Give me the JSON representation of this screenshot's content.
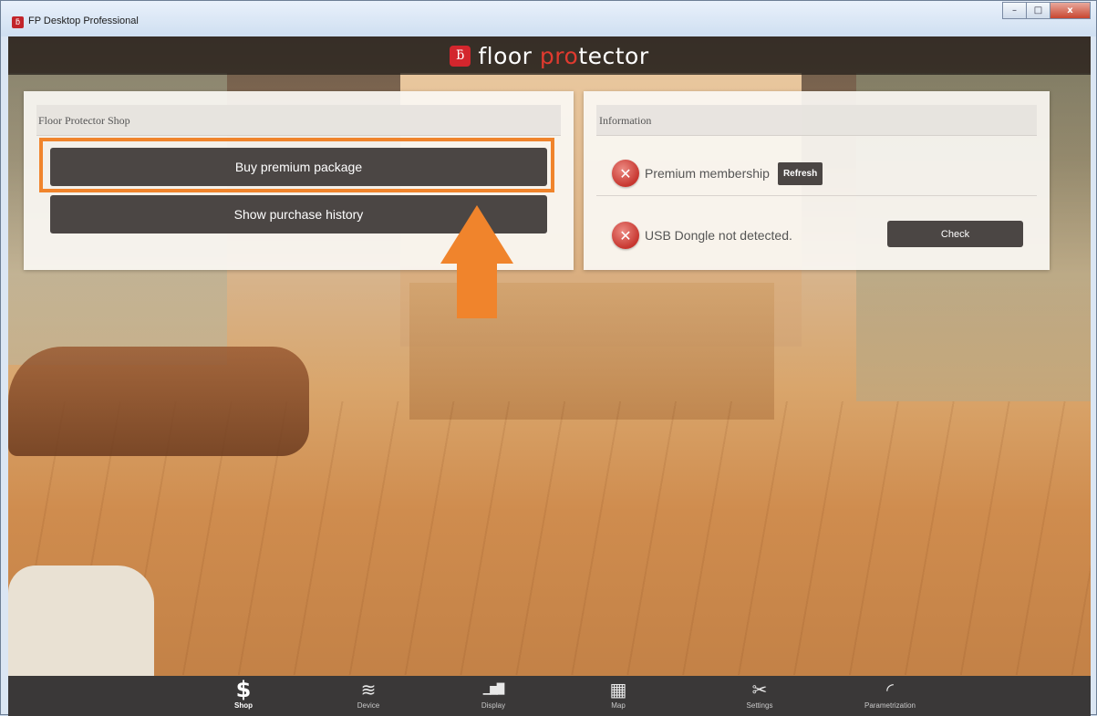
{
  "window": {
    "title": "FP Desktop Professional",
    "app_icon": "floor-protector-logo-icon"
  },
  "window_controls": {
    "minimize": "–",
    "maximize": "□",
    "close": "x"
  },
  "header": {
    "logo_text_main": "floor ",
    "logo_text_accent": "pro",
    "logo_text_end": "tector",
    "logo_mark": "ƃ",
    "accent_color": "#e03a2f"
  },
  "shop": {
    "title": "Floor Protector Shop",
    "buy_label": "Buy premium package",
    "history_label": "Show purchase history",
    "highlight_color": "#f0842c"
  },
  "info": {
    "title": "Information",
    "premium_label": "Premium membership",
    "refresh_label": "Refresh",
    "usb_label": "USB Dongle not detected.",
    "check_label": "Check",
    "error_icon_glyph": "✕",
    "error_color": "#c7362f"
  },
  "nav": {
    "items": [
      {
        "label": "Shop",
        "icon": "dollar-icon",
        "glyph": "$"
      },
      {
        "label": "Device",
        "icon": "layers-icon",
        "glyph": "≋"
      },
      {
        "label": "Display",
        "icon": "bar-chart-icon",
        "glyph": "▁▆█"
      },
      {
        "label": "Map",
        "icon": "map-icon",
        "glyph": "▦"
      },
      {
        "label": "Settings",
        "icon": "tools-icon",
        "glyph": "✂"
      },
      {
        "label": "Parametrization",
        "icon": "gauge-icon",
        "glyph": "◜"
      }
    ],
    "active": "Shop"
  }
}
